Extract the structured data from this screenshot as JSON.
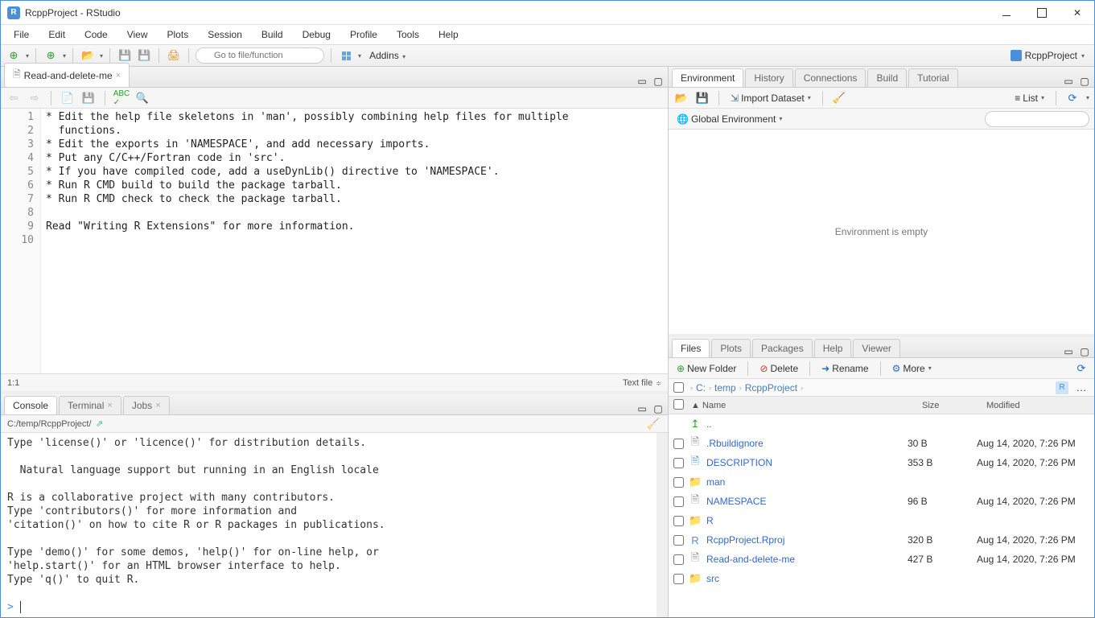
{
  "window": {
    "title": "RcppProject - RStudio",
    "app_letter": "R"
  },
  "menubar": [
    "File",
    "Edit",
    "Code",
    "View",
    "Plots",
    "Session",
    "Build",
    "Debug",
    "Profile",
    "Tools",
    "Help"
  ],
  "toolbar": {
    "goto_placeholder": "Go to file/function",
    "addins_label": "Addins",
    "project_name": "RcppProject"
  },
  "source": {
    "tab_label": "Read-and-delete-me",
    "line_numbers": [
      "1",
      "2",
      "3",
      "4",
      "5",
      "6",
      "7",
      "8",
      "9",
      "10"
    ],
    "code": "* Edit the help file skeletons in 'man', possibly combining help files for multiple\n  functions.\n* Edit the exports in 'NAMESPACE', and add necessary imports.\n* Put any C/C++/Fortran code in 'src'.\n* If you have compiled code, add a useDynLib() directive to 'NAMESPACE'.\n* Run R CMD build to build the package tarball.\n* Run R CMD check to check the package tarball.\n\nRead \"Writing R Extensions\" for more information.\n",
    "cursor_pos": "1:1",
    "file_type": "Text file"
  },
  "console": {
    "tabs": [
      "Console",
      "Terminal",
      "Jobs"
    ],
    "active_tab": 0,
    "path": "C:/temp/RcppProject/",
    "body": "Type 'license()' or 'licence()' for distribution details.\n\n  Natural language support but running in an English locale\n\nR is a collaborative project with many contributors.\nType 'contributors()' for more information and\n'citation()' on how to cite R or R packages in publications.\n\nType 'demo()' for some demos, 'help()' for on-line help, or\n'help.start()' for an HTML browser interface to help.\nType 'q()' to quit R.\n",
    "prompt": "> "
  },
  "env": {
    "tabs": [
      "Environment",
      "History",
      "Connections",
      "Build",
      "Tutorial"
    ],
    "active_tab": 0,
    "import_label": "Import Dataset",
    "scope_label": "Global Environment",
    "list_label": "List",
    "empty_msg": "Environment is empty"
  },
  "files": {
    "tabs": [
      "Files",
      "Plots",
      "Packages",
      "Help",
      "Viewer"
    ],
    "active_tab": 0,
    "buttons": {
      "new_folder": "New Folder",
      "delete": "Delete",
      "rename": "Rename",
      "more": "More"
    },
    "breadcrumb": [
      "C:",
      "temp",
      "RcppProject"
    ],
    "columns": {
      "name": "Name",
      "size": "Size",
      "modified": "Modified"
    },
    "entries": [
      {
        "icon": "up",
        "name": "..",
        "size": "",
        "modified": ""
      },
      {
        "icon": "file",
        "name": ".Rbuildignore",
        "size": "30 B",
        "modified": "Aug 14, 2020, 7:26 PM"
      },
      {
        "icon": "desc",
        "name": "DESCRIPTION",
        "size": "353 B",
        "modified": "Aug 14, 2020, 7:26 PM"
      },
      {
        "icon": "folder",
        "name": "man",
        "size": "",
        "modified": ""
      },
      {
        "icon": "file",
        "name": "NAMESPACE",
        "size": "96 B",
        "modified": "Aug 14, 2020, 7:26 PM"
      },
      {
        "icon": "folder",
        "name": "R",
        "size": "",
        "modified": ""
      },
      {
        "icon": "rproj",
        "name": "RcppProject.Rproj",
        "size": "320 B",
        "modified": "Aug 14, 2020, 7:26 PM"
      },
      {
        "icon": "file",
        "name": "Read-and-delete-me",
        "size": "427 B",
        "modified": "Aug 14, 2020, 7:26 PM"
      },
      {
        "icon": "folder",
        "name": "src",
        "size": "",
        "modified": ""
      }
    ]
  }
}
